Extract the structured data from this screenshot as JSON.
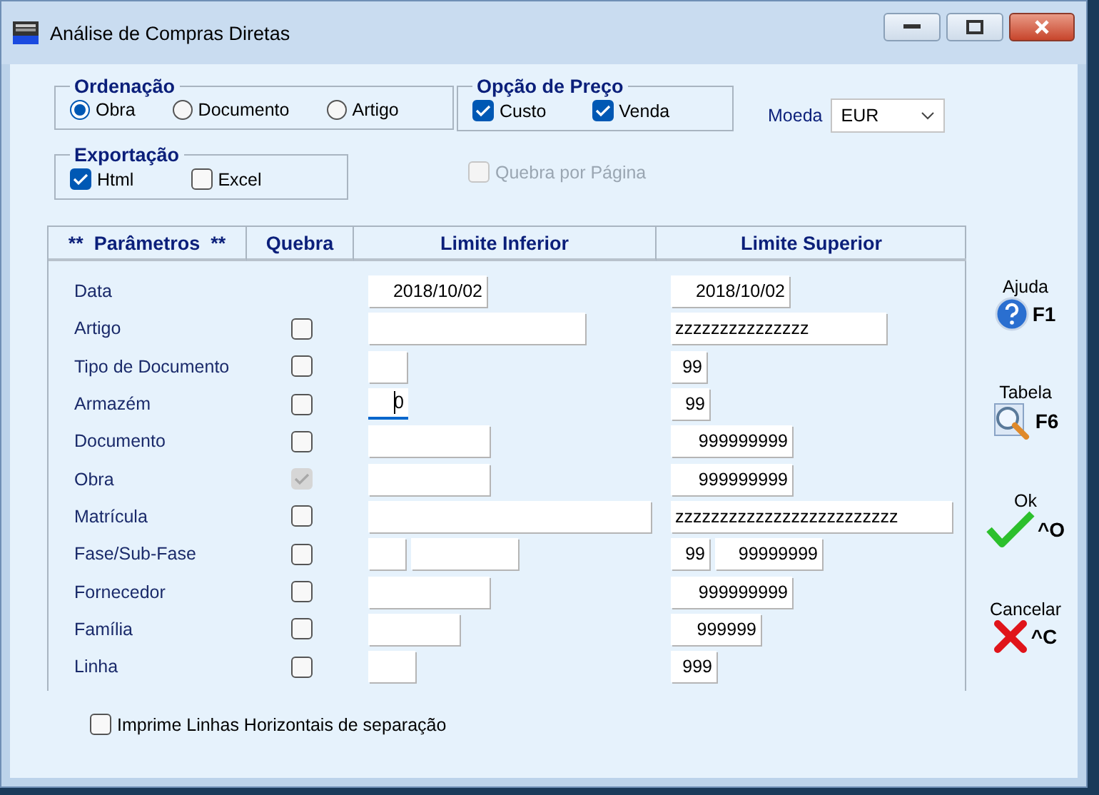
{
  "window": {
    "title": "Análise de Compras Diretas"
  },
  "ordenacao": {
    "title": "Ordenação",
    "options": [
      {
        "label": "Obra",
        "selected": true
      },
      {
        "label": "Documento",
        "selected": false
      },
      {
        "label": "Artigo",
        "selected": false
      }
    ]
  },
  "opcao_preco": {
    "title": "Opção de Preço",
    "options": [
      {
        "label": "Custo",
        "checked": true
      },
      {
        "label": "Venda",
        "checked": true
      }
    ]
  },
  "moeda": {
    "label": "Moeda",
    "value": "EUR"
  },
  "exportacao": {
    "title": "Exportação",
    "options": [
      {
        "label": "Html",
        "checked": true
      },
      {
        "label": "Excel",
        "checked": false
      }
    ]
  },
  "quebra_pagina": {
    "label": "Quebra por Página",
    "checked": false,
    "disabled": true
  },
  "table": {
    "columns": [
      "**  Parâmetros  **",
      "Quebra",
      "Limite Inferior",
      "Limite Superior"
    ],
    "rows": [
      {
        "label": "Data",
        "quebra": null,
        "inferior": [
          {
            "value": "2018/10/02",
            "focused": false
          }
        ],
        "superior": [
          {
            "value": "2018/10/02"
          }
        ]
      },
      {
        "label": "Artigo",
        "quebra": {
          "checked": false,
          "disabled": false
        },
        "inferior": [
          {
            "focused": false
          }
        ],
        "superior": [
          {
            "value": "zzzzzzzzzzzzzzz"
          }
        ]
      },
      {
        "label": "Tipo de Documento",
        "quebra": {
          "checked": false,
          "disabled": false
        },
        "inferior": [
          {
            "focused": false
          }
        ],
        "superior": [
          {
            "value": "99"
          }
        ]
      },
      {
        "label": "Armazém",
        "quebra": {
          "checked": false,
          "disabled": false
        },
        "inferior": [
          {
            "value": "0",
            "focused": true
          }
        ],
        "superior": [
          {
            "value": "99"
          }
        ]
      },
      {
        "label": "Documento",
        "quebra": {
          "checked": false,
          "disabled": false
        },
        "inferior": [
          {
            "focused": false
          }
        ],
        "superior": [
          {
            "value": "999999999"
          }
        ]
      },
      {
        "label": "Obra",
        "quebra": {
          "checked": true,
          "disabled": true
        },
        "inferior": [
          {
            "focused": false
          }
        ],
        "superior": [
          {
            "value": "999999999"
          }
        ]
      },
      {
        "label": "Matrícula",
        "quebra": {
          "checked": false,
          "disabled": false
        },
        "inferior": [
          {
            "focused": false
          }
        ],
        "superior": [
          {
            "value": "zzzzzzzzzzzzzzzzzzzzzzzzz"
          }
        ]
      },
      {
        "label": "Fase/Sub-Fase",
        "quebra": {
          "checked": false,
          "disabled": false
        },
        "inferior": [
          {
            "focused": false
          },
          {
            "focused": false
          }
        ],
        "superior": [
          {
            "value": "99"
          },
          {
            "value": "99999999"
          }
        ]
      },
      {
        "label": "Fornecedor",
        "quebra": {
          "checked": false,
          "disabled": false
        },
        "inferior": [
          {
            "focused": false
          }
        ],
        "superior": [
          {
            "value": "999999999"
          }
        ]
      },
      {
        "label": "Família",
        "quebra": {
          "checked": false,
          "disabled": false
        },
        "inferior": [
          {
            "focused": false
          }
        ],
        "superior": [
          {
            "value": "999999"
          }
        ]
      },
      {
        "label": "Linha",
        "quebra": {
          "checked": false,
          "disabled": false
        },
        "inferior": [
          {
            "focused": false
          }
        ],
        "superior": [
          {
            "value": "999"
          }
        ]
      }
    ]
  },
  "actions": [
    {
      "kind": "help",
      "label": "Ajuda",
      "key": "F1"
    },
    {
      "kind": "table",
      "label": "Tabela",
      "key": "F6"
    },
    {
      "kind": "ok",
      "label": "Ok",
      "key": "^O"
    },
    {
      "kind": "cancel",
      "label": "Cancelar",
      "key": "^C"
    }
  ],
  "imprime_linhas": {
    "label": "Imprime Linhas Horizontais de separação",
    "checked": false
  }
}
